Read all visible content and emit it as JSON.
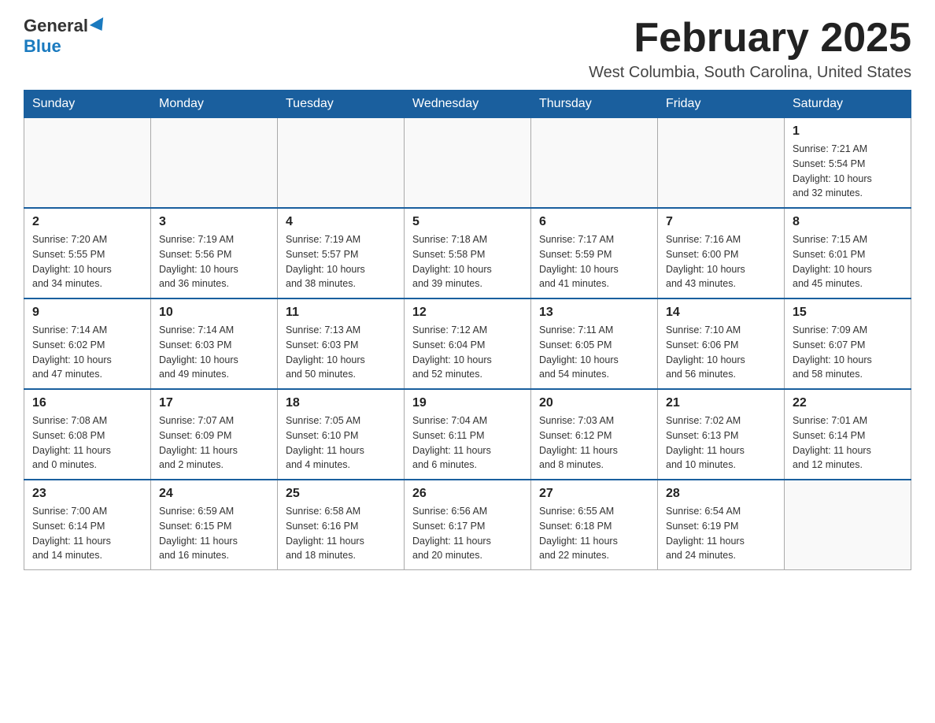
{
  "header": {
    "logo_general": "General",
    "logo_blue": "Blue",
    "month_title": "February 2025",
    "location": "West Columbia, South Carolina, United States"
  },
  "days_of_week": [
    "Sunday",
    "Monday",
    "Tuesday",
    "Wednesday",
    "Thursday",
    "Friday",
    "Saturday"
  ],
  "weeks": [
    [
      {
        "day": "",
        "info": ""
      },
      {
        "day": "",
        "info": ""
      },
      {
        "day": "",
        "info": ""
      },
      {
        "day": "",
        "info": ""
      },
      {
        "day": "",
        "info": ""
      },
      {
        "day": "",
        "info": ""
      },
      {
        "day": "1",
        "info": "Sunrise: 7:21 AM\nSunset: 5:54 PM\nDaylight: 10 hours\nand 32 minutes."
      }
    ],
    [
      {
        "day": "2",
        "info": "Sunrise: 7:20 AM\nSunset: 5:55 PM\nDaylight: 10 hours\nand 34 minutes."
      },
      {
        "day": "3",
        "info": "Sunrise: 7:19 AM\nSunset: 5:56 PM\nDaylight: 10 hours\nand 36 minutes."
      },
      {
        "day": "4",
        "info": "Sunrise: 7:19 AM\nSunset: 5:57 PM\nDaylight: 10 hours\nand 38 minutes."
      },
      {
        "day": "5",
        "info": "Sunrise: 7:18 AM\nSunset: 5:58 PM\nDaylight: 10 hours\nand 39 minutes."
      },
      {
        "day": "6",
        "info": "Sunrise: 7:17 AM\nSunset: 5:59 PM\nDaylight: 10 hours\nand 41 minutes."
      },
      {
        "day": "7",
        "info": "Sunrise: 7:16 AM\nSunset: 6:00 PM\nDaylight: 10 hours\nand 43 minutes."
      },
      {
        "day": "8",
        "info": "Sunrise: 7:15 AM\nSunset: 6:01 PM\nDaylight: 10 hours\nand 45 minutes."
      }
    ],
    [
      {
        "day": "9",
        "info": "Sunrise: 7:14 AM\nSunset: 6:02 PM\nDaylight: 10 hours\nand 47 minutes."
      },
      {
        "day": "10",
        "info": "Sunrise: 7:14 AM\nSunset: 6:03 PM\nDaylight: 10 hours\nand 49 minutes."
      },
      {
        "day": "11",
        "info": "Sunrise: 7:13 AM\nSunset: 6:03 PM\nDaylight: 10 hours\nand 50 minutes."
      },
      {
        "day": "12",
        "info": "Sunrise: 7:12 AM\nSunset: 6:04 PM\nDaylight: 10 hours\nand 52 minutes."
      },
      {
        "day": "13",
        "info": "Sunrise: 7:11 AM\nSunset: 6:05 PM\nDaylight: 10 hours\nand 54 minutes."
      },
      {
        "day": "14",
        "info": "Sunrise: 7:10 AM\nSunset: 6:06 PM\nDaylight: 10 hours\nand 56 minutes."
      },
      {
        "day": "15",
        "info": "Sunrise: 7:09 AM\nSunset: 6:07 PM\nDaylight: 10 hours\nand 58 minutes."
      }
    ],
    [
      {
        "day": "16",
        "info": "Sunrise: 7:08 AM\nSunset: 6:08 PM\nDaylight: 11 hours\nand 0 minutes."
      },
      {
        "day": "17",
        "info": "Sunrise: 7:07 AM\nSunset: 6:09 PM\nDaylight: 11 hours\nand 2 minutes."
      },
      {
        "day": "18",
        "info": "Sunrise: 7:05 AM\nSunset: 6:10 PM\nDaylight: 11 hours\nand 4 minutes."
      },
      {
        "day": "19",
        "info": "Sunrise: 7:04 AM\nSunset: 6:11 PM\nDaylight: 11 hours\nand 6 minutes."
      },
      {
        "day": "20",
        "info": "Sunrise: 7:03 AM\nSunset: 6:12 PM\nDaylight: 11 hours\nand 8 minutes."
      },
      {
        "day": "21",
        "info": "Sunrise: 7:02 AM\nSunset: 6:13 PM\nDaylight: 11 hours\nand 10 minutes."
      },
      {
        "day": "22",
        "info": "Sunrise: 7:01 AM\nSunset: 6:14 PM\nDaylight: 11 hours\nand 12 minutes."
      }
    ],
    [
      {
        "day": "23",
        "info": "Sunrise: 7:00 AM\nSunset: 6:14 PM\nDaylight: 11 hours\nand 14 minutes."
      },
      {
        "day": "24",
        "info": "Sunrise: 6:59 AM\nSunset: 6:15 PM\nDaylight: 11 hours\nand 16 minutes."
      },
      {
        "day": "25",
        "info": "Sunrise: 6:58 AM\nSunset: 6:16 PM\nDaylight: 11 hours\nand 18 minutes."
      },
      {
        "day": "26",
        "info": "Sunrise: 6:56 AM\nSunset: 6:17 PM\nDaylight: 11 hours\nand 20 minutes."
      },
      {
        "day": "27",
        "info": "Sunrise: 6:55 AM\nSunset: 6:18 PM\nDaylight: 11 hours\nand 22 minutes."
      },
      {
        "day": "28",
        "info": "Sunrise: 6:54 AM\nSunset: 6:19 PM\nDaylight: 11 hours\nand 24 minutes."
      },
      {
        "day": "",
        "info": ""
      }
    ]
  ]
}
